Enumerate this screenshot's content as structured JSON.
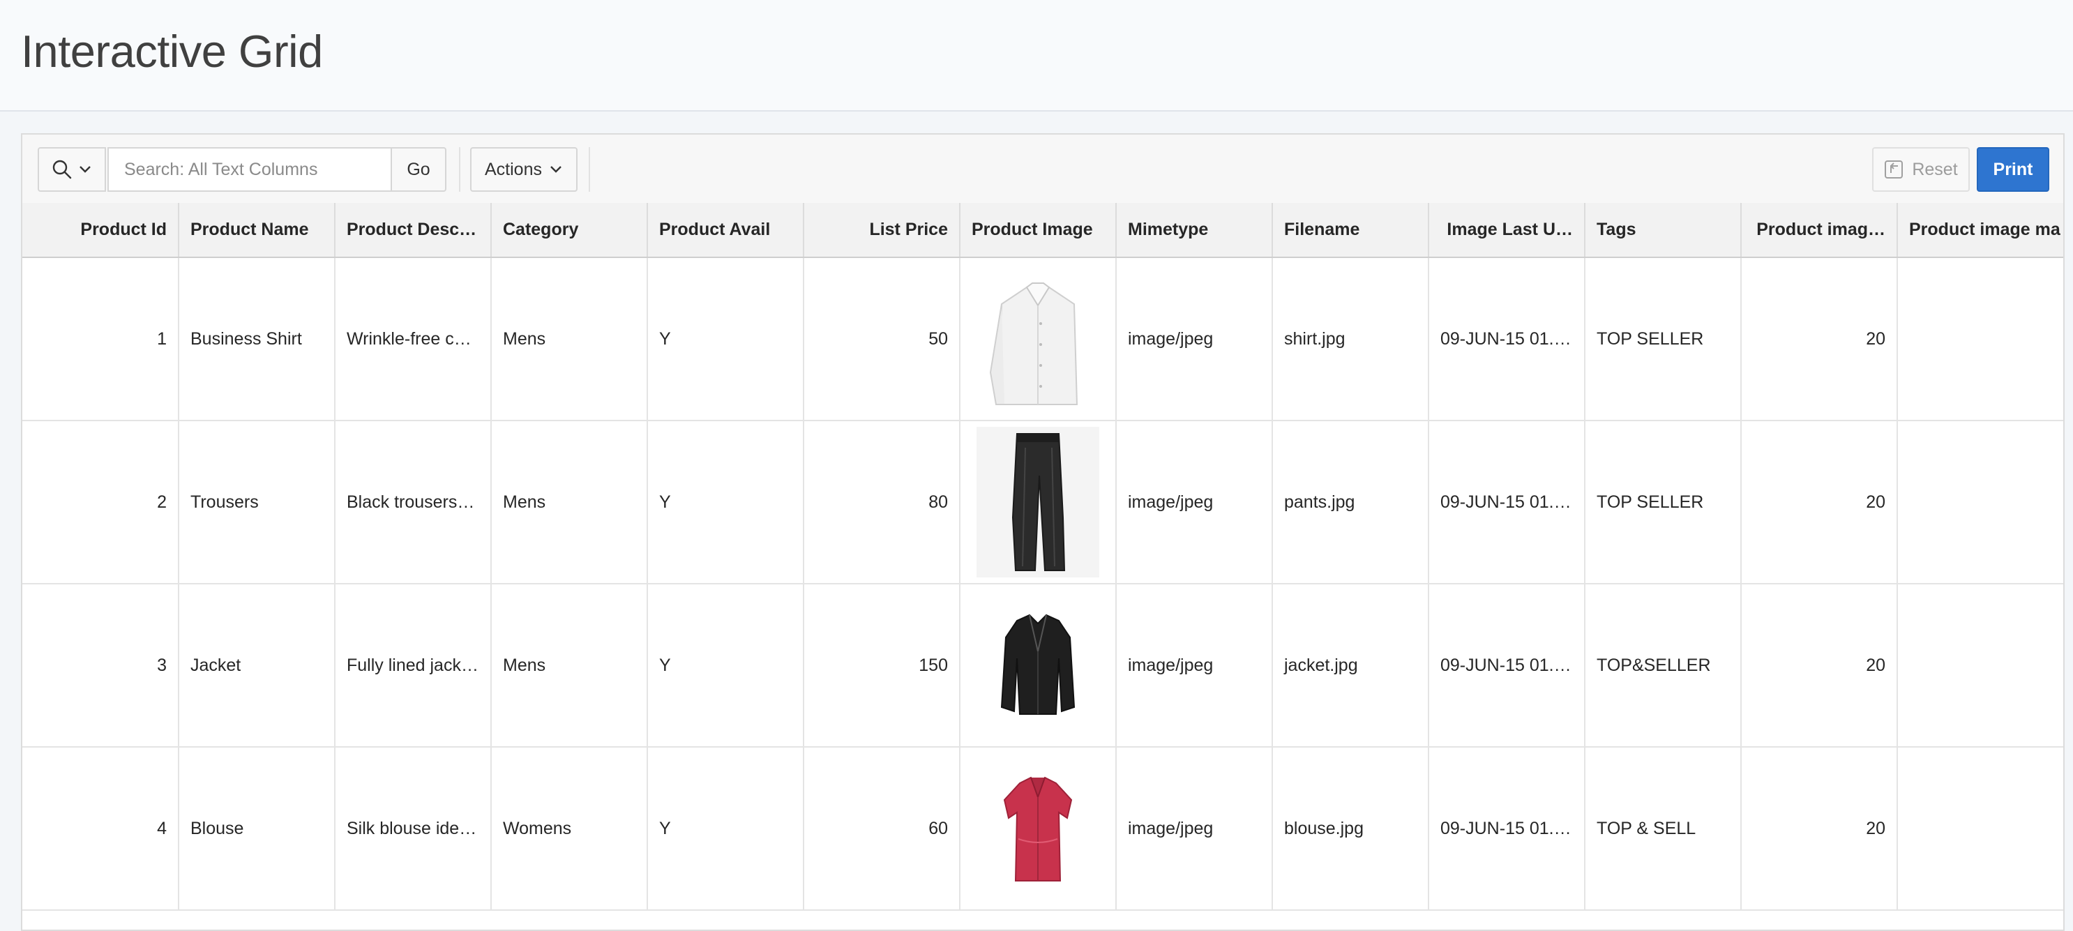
{
  "page": {
    "title": "Interactive Grid"
  },
  "toolbar": {
    "search_placeholder": "Search: All Text Columns",
    "go_label": "Go",
    "actions_label": "Actions",
    "reset_label": "Reset",
    "print_label": "Print",
    "print_color": "#2e75d0"
  },
  "columns": [
    "Product Id",
    "Product Name",
    "Product Descr…",
    "Category",
    "Product Avail",
    "List Price",
    "Product Image",
    "Mimetype",
    "Filename",
    "Image Last U…",
    "Tags",
    "Product imag…",
    "Product image ma"
  ],
  "rows": [
    {
      "id": "1",
      "name": "Business Shirt",
      "desc": "Wrinkle-free co…",
      "category": "Mens",
      "avail": "Y",
      "price": "50",
      "image": "shirt",
      "mimetype": "image/jpeg",
      "filename": "shirt.jpg",
      "updated": "09-JUN-15 01.…",
      "tags": "TOP SELLER",
      "img_num": "20"
    },
    {
      "id": "2",
      "name": "Trousers",
      "desc": "Black trousers …",
      "category": "Mens",
      "avail": "Y",
      "price": "80",
      "image": "trousers",
      "mimetype": "image/jpeg",
      "filename": "pants.jpg",
      "updated": "09-JUN-15 01.…",
      "tags": "TOP SELLER",
      "img_num": "20"
    },
    {
      "id": "3",
      "name": "Jacket",
      "desc": "Fully lined jack…",
      "category": "Mens",
      "avail": "Y",
      "price": "150",
      "image": "jacket",
      "mimetype": "image/jpeg",
      "filename": "jacket.jpg",
      "updated": "09-JUN-15 01.…",
      "tags": "TOP&SELLER",
      "img_num": "20"
    },
    {
      "id": "4",
      "name": "Blouse",
      "desc": "Silk blouse ide…",
      "category": "Womens",
      "avail": "Y",
      "price": "60",
      "image": "blouse",
      "mimetype": "image/jpeg",
      "filename": "blouse.jpg",
      "updated": "09-JUN-15 01.…",
      "tags": "TOP & SELL",
      "img_num": "20"
    }
  ]
}
